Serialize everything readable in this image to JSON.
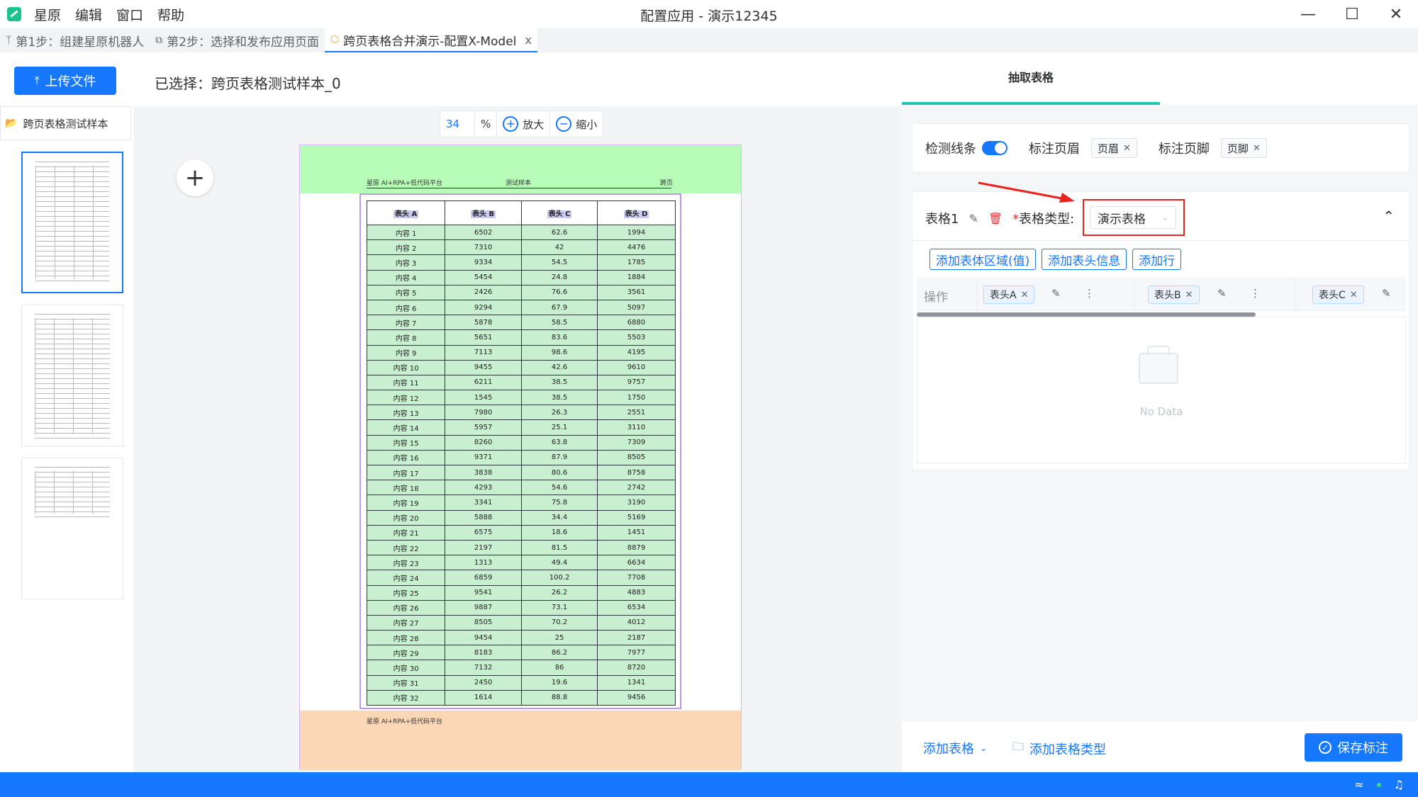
{
  "app": {
    "menu": [
      "星原",
      "编辑",
      "窗口",
      "帮助"
    ],
    "window_title": "配置应用 - 演示12345"
  },
  "tabs": [
    {
      "label": "第1步：组建星原机器人",
      "icon": "branch-icon"
    },
    {
      "label": "第2步：选择和发布应用页面",
      "icon": "publish-icon"
    },
    {
      "label": "跨页表格合并演示-配置X-Model",
      "icon": "cube-icon",
      "active": true,
      "close": "x"
    }
  ],
  "toolbar": {
    "upload_label": "上传文件",
    "selected_text": "已选择：跨页表格测试样本_0"
  },
  "files": {
    "folder_label": "跨页表格测试样本"
  },
  "zoom": {
    "value": "34",
    "unit": "%",
    "zoom_in": "放大",
    "zoom_out": "缩小"
  },
  "document": {
    "header_left": "星原 AI+RPA+低代码平台",
    "header_center": "测试样本",
    "header_right": "跨页",
    "footer_text": "星原 AI+RPA+低代码平台",
    "columns": [
      "表头 A",
      "表头 B",
      "表头 C",
      "表头 D"
    ],
    "rows": [
      [
        "内容 1",
        "6502",
        "62.6",
        "1994"
      ],
      [
        "内容 2",
        "7310",
        "42",
        "4476"
      ],
      [
        "内容 3",
        "9334",
        "54.5",
        "1785"
      ],
      [
        "内容 4",
        "5454",
        "24.8",
        "1884"
      ],
      [
        "内容 5",
        "2426",
        "76.6",
        "3561"
      ],
      [
        "内容 6",
        "9294",
        "67.9",
        "5097"
      ],
      [
        "内容 7",
        "5878",
        "58.5",
        "6880"
      ],
      [
        "内容 8",
        "5651",
        "83.6",
        "5503"
      ],
      [
        "内容 9",
        "7113",
        "98.6",
        "4195"
      ],
      [
        "内容 10",
        "9455",
        "42.6",
        "9610"
      ],
      [
        "内容 11",
        "6211",
        "38.5",
        "9757"
      ],
      [
        "内容 12",
        "1545",
        "38.5",
        "1750"
      ],
      [
        "内容 13",
        "7980",
        "26.3",
        "2551"
      ],
      [
        "内容 14",
        "5957",
        "25.1",
        "3110"
      ],
      [
        "内容 15",
        "8260",
        "63.8",
        "7309"
      ],
      [
        "内容 16",
        "9371",
        "87.9",
        "8505"
      ],
      [
        "内容 17",
        "3838",
        "80.6",
        "8758"
      ],
      [
        "内容 18",
        "4293",
        "54.6",
        "2742"
      ],
      [
        "内容 19",
        "3341",
        "75.8",
        "3190"
      ],
      [
        "内容 20",
        "5888",
        "34.4",
        "5169"
      ],
      [
        "内容 21",
        "6575",
        "18.6",
        "1451"
      ],
      [
        "内容 22",
        "2197",
        "81.5",
        "8879"
      ],
      [
        "内容 23",
        "1313",
        "49.4",
        "6634"
      ],
      [
        "内容 24",
        "6859",
        "100.2",
        "7708"
      ],
      [
        "内容 25",
        "9541",
        "26.2",
        "4883"
      ],
      [
        "内容 26",
        "9887",
        "73.1",
        "6534"
      ],
      [
        "内容 27",
        "8505",
        "70.2",
        "4012"
      ],
      [
        "内容 28",
        "9454",
        "25",
        "2187"
      ],
      [
        "内容 29",
        "8183",
        "86.2",
        "7977"
      ],
      [
        "内容 30",
        "7132",
        "86",
        "8720"
      ],
      [
        "内容 31",
        "2450",
        "19.6",
        "1341"
      ],
      [
        "内容 32",
        "1614",
        "88.8",
        "9456"
      ]
    ]
  },
  "right_panel": {
    "tab_label": "抽取表格",
    "detect_lines_label": "检测线条",
    "mark_header_label": "标注页眉",
    "header_tag": "页眉",
    "mark_footer_label": "标注页脚",
    "footer_tag": "页脚",
    "table_name": "表格1",
    "required_mark": "*",
    "table_type_label": "表格类型:",
    "table_type_value": "演示表格",
    "buttons": [
      "添加表体区域(值)",
      "添加表头信息",
      "添加行"
    ],
    "grid_op_label": "操作",
    "grid_columns": [
      "表头A",
      "表头B",
      "表头C"
    ],
    "empty_text": "No Data",
    "add_table_label": "添加表格",
    "add_table_type_label": "添加表格类型",
    "save_label": "保存标注"
  },
  "colors": {
    "primary": "#1677ff",
    "header_band": "#b7fdb7",
    "footer_band": "#fcd7b6",
    "highlight": "#e8221d",
    "active_tab_underline": "#22c5b0"
  }
}
